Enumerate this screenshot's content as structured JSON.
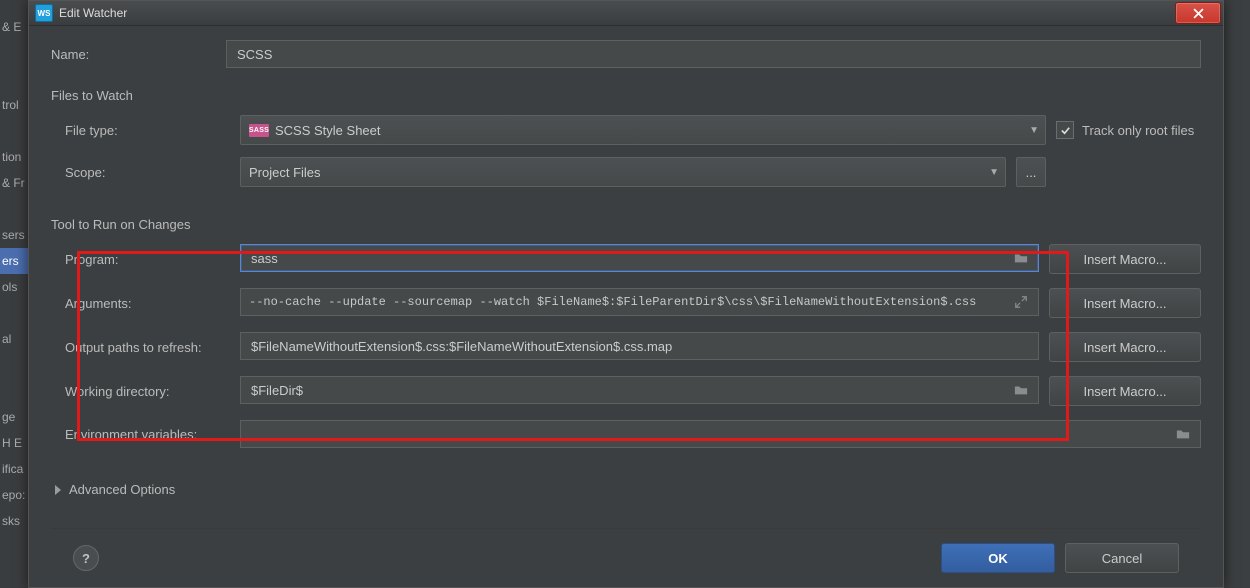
{
  "bg_sidebar": {
    "items": [
      "& E",
      "",
      "",
      "trol",
      "",
      "tion",
      "& Fr",
      "",
      "sers",
      "ers",
      "ols",
      "",
      "al",
      "",
      "",
      "ge",
      "H E",
      "ifica",
      "epo:",
      "sks"
    ],
    "selected_index": 9
  },
  "dialog": {
    "badge": "WS",
    "title": "Edit Watcher",
    "close_label": "Close"
  },
  "fields": {
    "name_label": "Name:",
    "name_value": "SCSS",
    "files_to_watch_header": "Files to Watch",
    "file_type_label": "File type:",
    "file_type_value": "SCSS Style Sheet",
    "file_type_badge": "SASS",
    "scope_label": "Scope:",
    "scope_value": "Project Files",
    "scope_more": "...",
    "track_root_label": "Track only root files",
    "track_root_checked": true,
    "tool_header": "Tool to Run on Changes",
    "program_label": "Program:",
    "program_value": "sass",
    "arguments_label": "Arguments:",
    "arguments_value": "--no-cache --update --sourcemap --watch $FileName$:$FileParentDir$\\css\\$FileNameWithoutExtension$.css",
    "output_label": "Output paths to refresh:",
    "output_value": "$FileNameWithoutExtension$.css:$FileNameWithoutExtension$.css.map",
    "workdir_label": "Working directory:",
    "workdir_value": "$FileDir$",
    "env_label": "Environment variables:",
    "env_value": "",
    "macro_btn": "Insert Macro...",
    "advanced_label": "Advanced Options"
  },
  "footer": {
    "help": "?",
    "ok": "OK",
    "cancel": "Cancel"
  }
}
